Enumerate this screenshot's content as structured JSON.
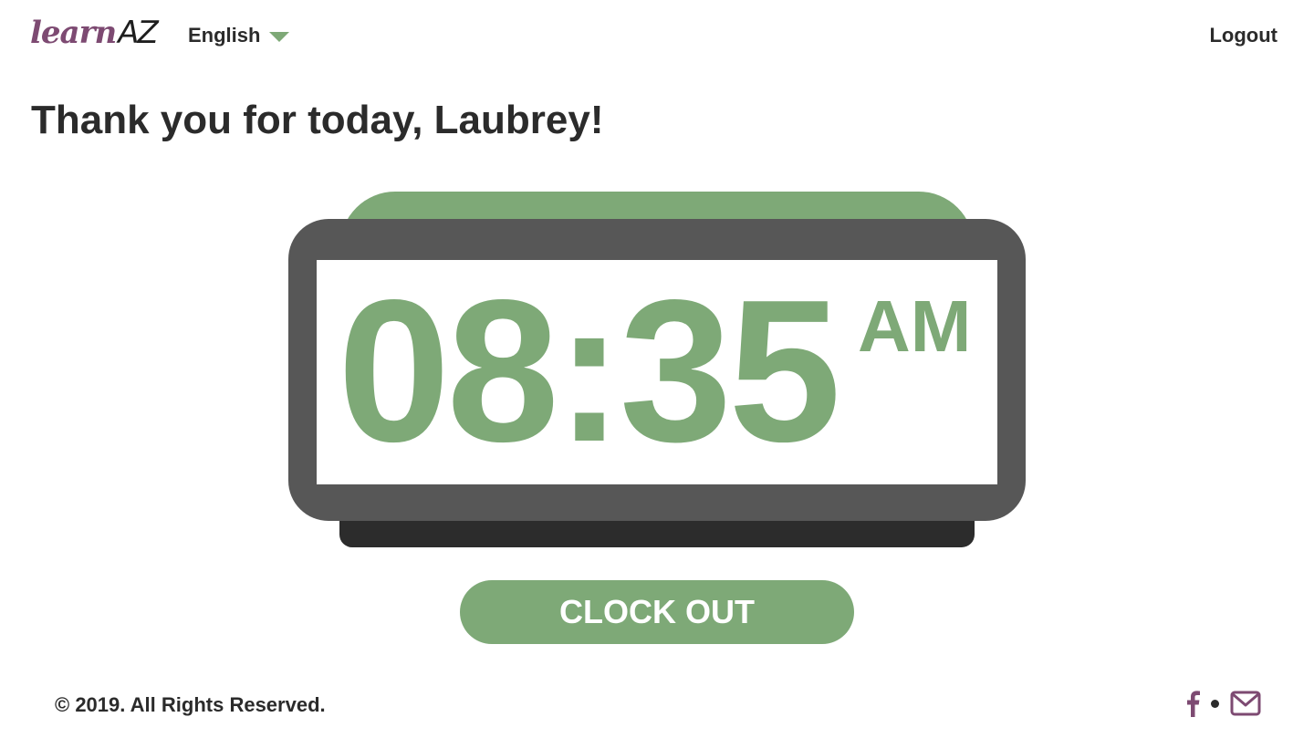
{
  "header": {
    "logo_learn": "learn",
    "logo_az": "AZ",
    "language": "English",
    "logout": "Logout"
  },
  "main": {
    "title": "Thank you for today, Laubrey!",
    "clock": {
      "time": "08:35",
      "ampm": "AM"
    },
    "clock_out_label": "CLOCK OUT"
  },
  "footer": {
    "copyright": "© 2019. All Rights Reserved."
  },
  "colors": {
    "accent_green": "#7ea977",
    "brand_purple": "#7d4a72",
    "clock_body": "#575757",
    "clock_base": "#2c2c2c",
    "text": "#2b2b2b"
  },
  "icons": [
    "chevron-down-icon",
    "facebook-icon",
    "mail-icon"
  ]
}
